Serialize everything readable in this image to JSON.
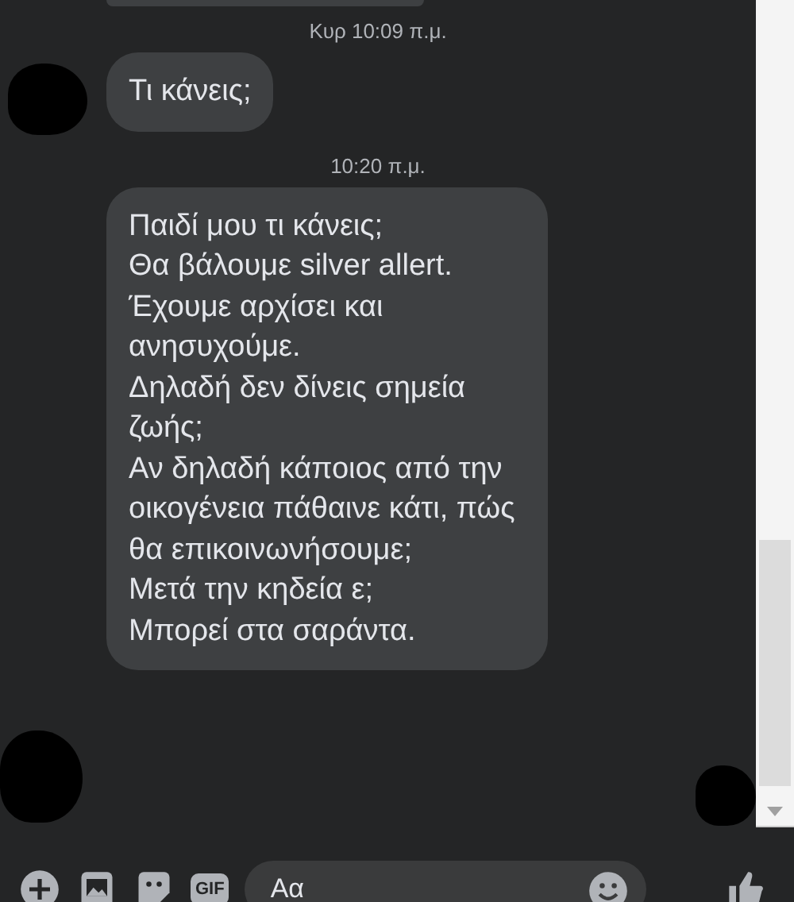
{
  "messages": [
    {
      "kind": "bubble-edge"
    },
    {
      "kind": "time",
      "text": "Κυρ 10:09 π.μ."
    },
    {
      "kind": "bubble",
      "text": "Τι κάνεις;"
    },
    {
      "kind": "time",
      "text": "10:20 π.μ."
    },
    {
      "kind": "bubble",
      "text": "Παιδί μου τι κάνεις;\nΘα βάλουμε silver allert.\nΈχουμε αρχίσει και ανησυχούμε.\nΔηλαδή δεν δίνεις σημεία ζωής;\nΑν δηλαδή κάποιος από την οικογένεια πάθαινε κάτι, πώς θα επικοινωνήσουμε;\nΜετά την κηδεία ε;\nΜπορεί στα σαράντα."
    }
  ],
  "composer": {
    "gif_label": "GIF",
    "placeholder": "Αα"
  }
}
